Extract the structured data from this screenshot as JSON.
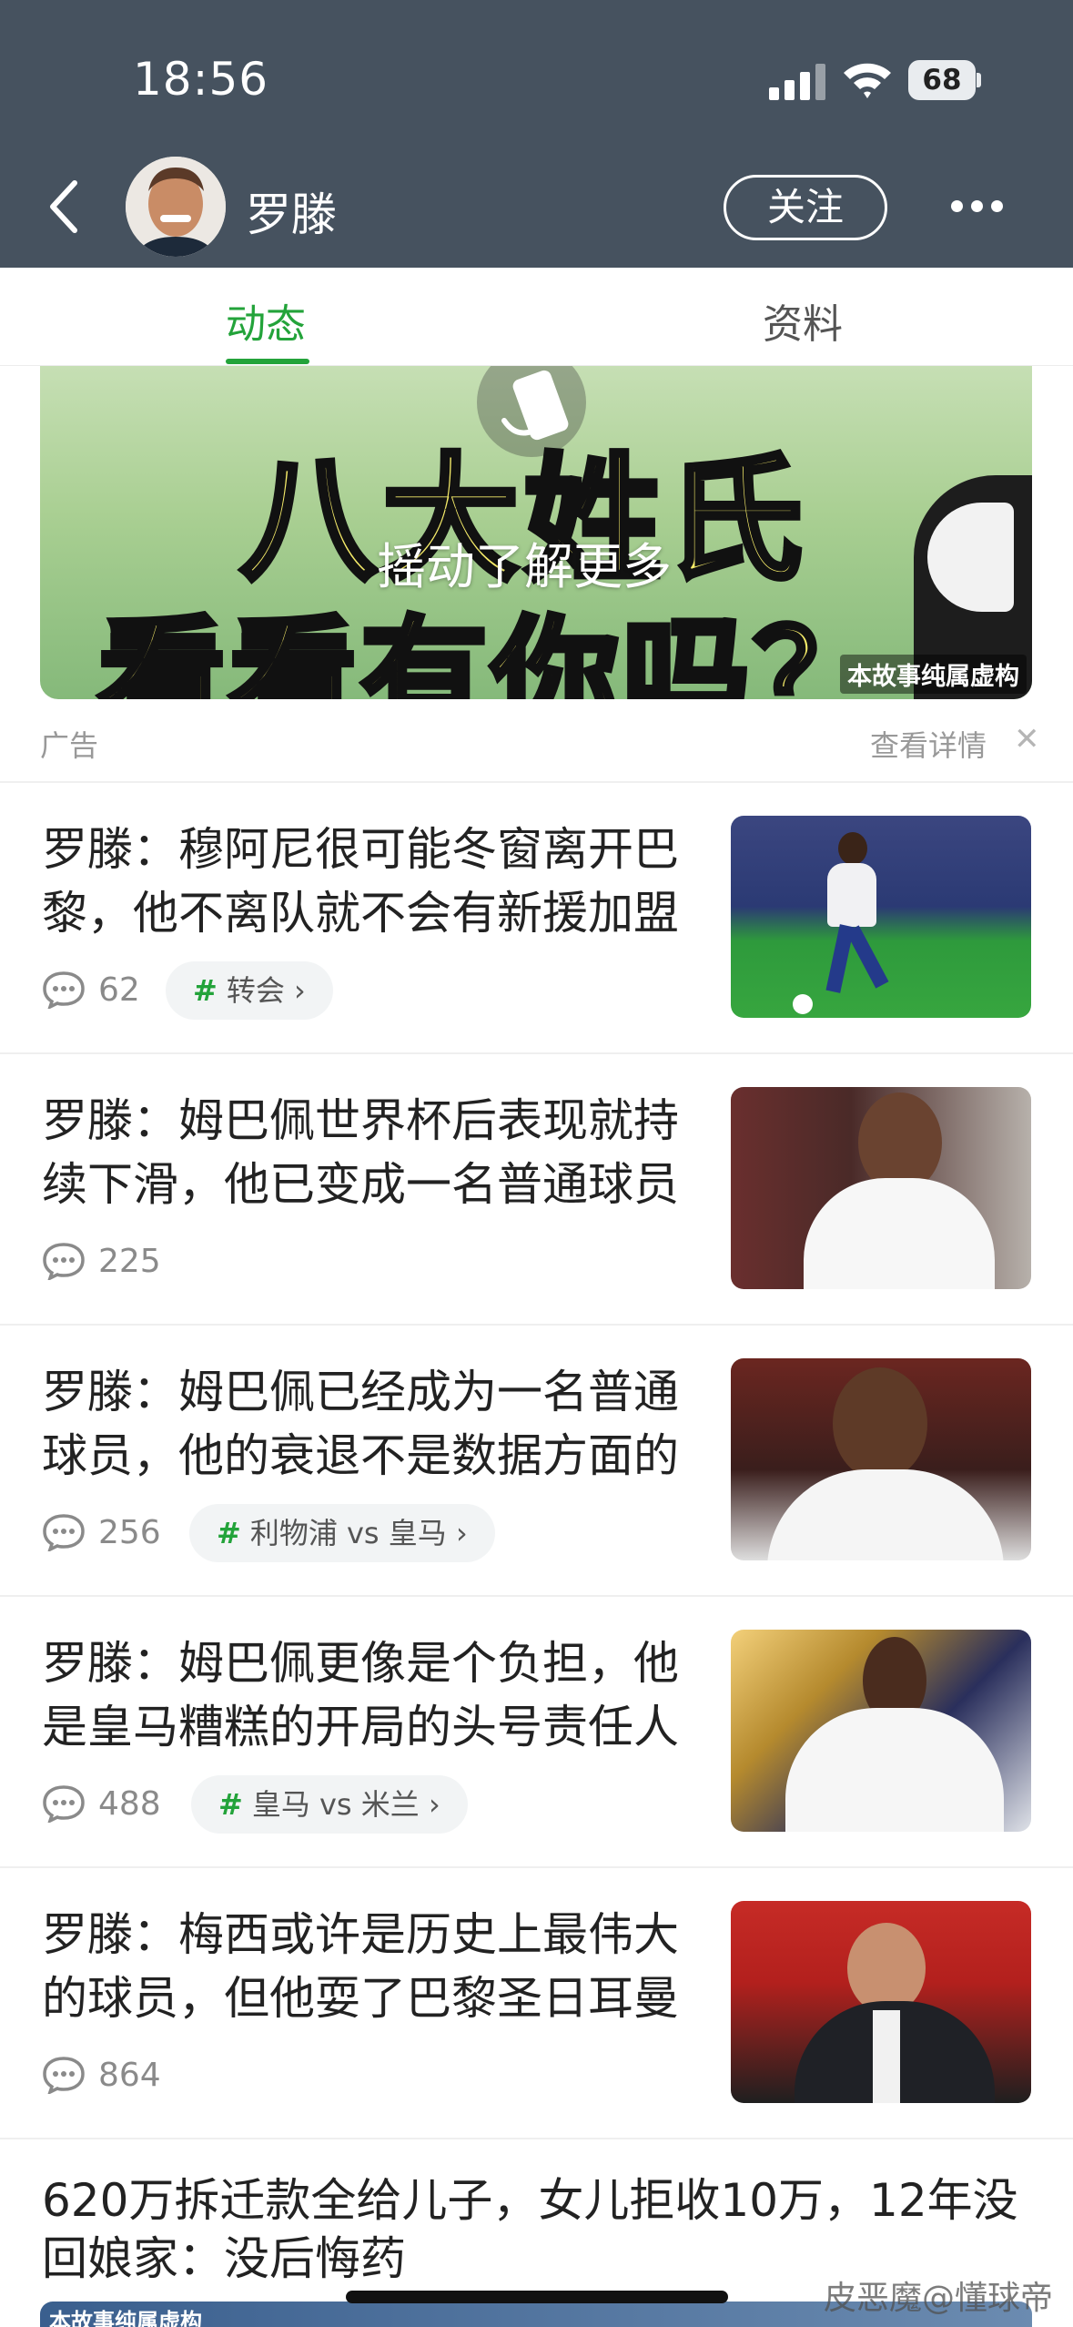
{
  "status_bar": {
    "time": "18:56",
    "battery": "68"
  },
  "header": {
    "profile_name": "罗滕",
    "follow_label": "关注"
  },
  "tabs": [
    {
      "label": "动态",
      "active": true
    },
    {
      "label": "资料",
      "active": false
    }
  ],
  "ad": {
    "headline_line1": "八大姓氏",
    "headline_line2": "看看有你吗？",
    "shake_prompt": "摇动了解更多",
    "disclaimer": "本故事纯属虚构",
    "label": "广告",
    "detail_link": "查看详情",
    "close_symbol": "✕"
  },
  "articles": [
    {
      "title": "罗滕：穆阿尼很可能冬窗离开巴黎，他不离队就不会有新援加盟",
      "comments": "62",
      "topic": "转会 ›"
    },
    {
      "title": "罗滕：姆巴佩世界杯后表现就持续下滑，他已变成一名普通球员",
      "comments": "225",
      "topic": ""
    },
    {
      "title": "罗滕：姆巴佩已经成为一名普通球员，他的衰退不是数据方面的",
      "comments": "256",
      "topic": "利物浦 vs 皇马 ›"
    },
    {
      "title": "罗滕：姆巴佩更像是个负担，他是皇马糟糕的开局的头号责任人",
      "comments": "488",
      "topic": "皇马 vs 米兰 ›"
    },
    {
      "title": "罗滕：梅西或许是历史上最伟大的球员，但他耍了巴黎圣日耳曼",
      "comments": "864",
      "topic": ""
    }
  ],
  "last_article": {
    "title": "620万拆迁款全给儿子，女儿拒收10万，12年没回娘家：没后悔药",
    "image_caption": "本故事纯属虚构"
  },
  "watermark": "皮恶魔@懂球帝",
  "colors": {
    "header_bg": "#46525f",
    "accent_green": "#23a33a"
  }
}
